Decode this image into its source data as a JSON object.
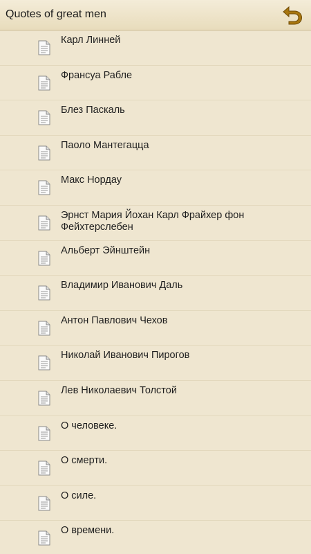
{
  "header": {
    "title": "Quotes of great men",
    "back_icon": "undo-arrow-icon"
  },
  "colors": {
    "background": "#efe6d0",
    "header_bg": "#ebe0c4",
    "back_icon": "#a8760f",
    "text": "#1f1f1f"
  },
  "list": {
    "item_icon": "document-icon",
    "items": [
      {
        "label": "Карл Линней"
      },
      {
        "label": "Франсуа Рабле"
      },
      {
        "label": "Блез Паскаль"
      },
      {
        "label": "Паоло Мантегацца"
      },
      {
        "label": "Макс Нордау"
      },
      {
        "label": "Эрнст Мария Йохан Карл Фрайхер фон Фейхтерслебен"
      },
      {
        "label": "Альберт Эйнштейн"
      },
      {
        "label": "Владимир Иванович Даль"
      },
      {
        "label": "Антон Павлович Чехов"
      },
      {
        "label": "Николай Иванович Пирогов"
      },
      {
        "label": "Лев Николаевич Толстой"
      },
      {
        "label": "О человеке."
      },
      {
        "label": "О смерти."
      },
      {
        "label": "О силе."
      },
      {
        "label": "О времени."
      }
    ]
  }
}
